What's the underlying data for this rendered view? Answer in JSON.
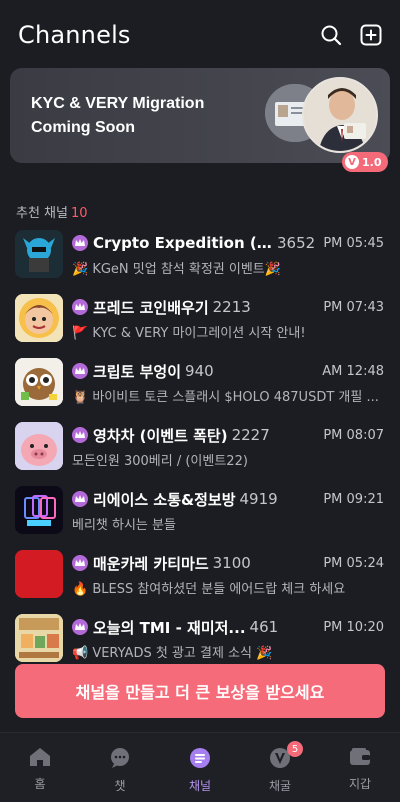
{
  "header": {
    "title": "Channels",
    "search_icon": "search-icon",
    "add_icon": "plus-square-icon"
  },
  "banner": {
    "line1": "KYC & VERY Migration",
    "line2": "Coming Soon",
    "version": "1.0",
    "version_logo": "V"
  },
  "section": {
    "title": "추천 채널",
    "count": "10"
  },
  "channels": [
    {
      "name": "Crypto Expedition ( ...",
      "count": "3652",
      "time": "PM 05:45",
      "message": "🎉 KGeN 밋업 참석 확정권 이벤트🎉",
      "thumb_color": "#1c2d36"
    },
    {
      "name": "프레드 코인배우기",
      "count": "2213",
      "time": "PM 07:43",
      "message": "🚩 KYC & VERY 마이그레이션 시작 안내!",
      "thumb_color": "#f3e3b8"
    },
    {
      "name": "크립토 부엉이",
      "count": "940",
      "time": "AM 12:48",
      "message": "🦉 바이비트 토큰 스플래시 $HOLO 487USDT 개필 ...",
      "thumb_color": "#f2f0e8"
    },
    {
      "name": "영차차 (이벤트 폭탄)",
      "count": "2227",
      "time": "PM 08:07",
      "message": "모든인원 300베리 / (이벤트22)",
      "thumb_color": "#d8d4f0"
    },
    {
      "name": "리에이스 소통&정보방",
      "count": "4919",
      "time": "PM 09:21",
      "message": "베리챗 하시는 분들",
      "thumb_color": "#0c0a16"
    },
    {
      "name": "매운카레 카티마드",
      "count": "3100",
      "time": "PM 05:24",
      "message": "🔥 BLESS 참여하셨던 분들 에어드랍 체크 하세요",
      "thumb_color": "#d31b23"
    },
    {
      "name": "오늘의 TMI - 재미저...",
      "count": "461",
      "time": "PM 10:20",
      "message": "📢 VERYADS 첫 광고 결제 소식 🎉",
      "thumb_color": "#e8d8a8"
    }
  ],
  "cta": {
    "label": "채널을 만들고 더 큰 보상을 받으세요"
  },
  "tabs": [
    {
      "label": "홈",
      "icon": "home-icon"
    },
    {
      "label": "챗",
      "icon": "chat-icon"
    },
    {
      "label": "채널",
      "icon": "channel-icon",
      "active": true
    },
    {
      "label": "채굴",
      "icon": "mining-icon",
      "badge": "5"
    },
    {
      "label": "지갑",
      "icon": "wallet-icon"
    }
  ],
  "colors": {
    "background": "#1c1d22",
    "accent": "#f56b79",
    "active_tab": "#b693f0",
    "crown": "#b26ad8"
  }
}
